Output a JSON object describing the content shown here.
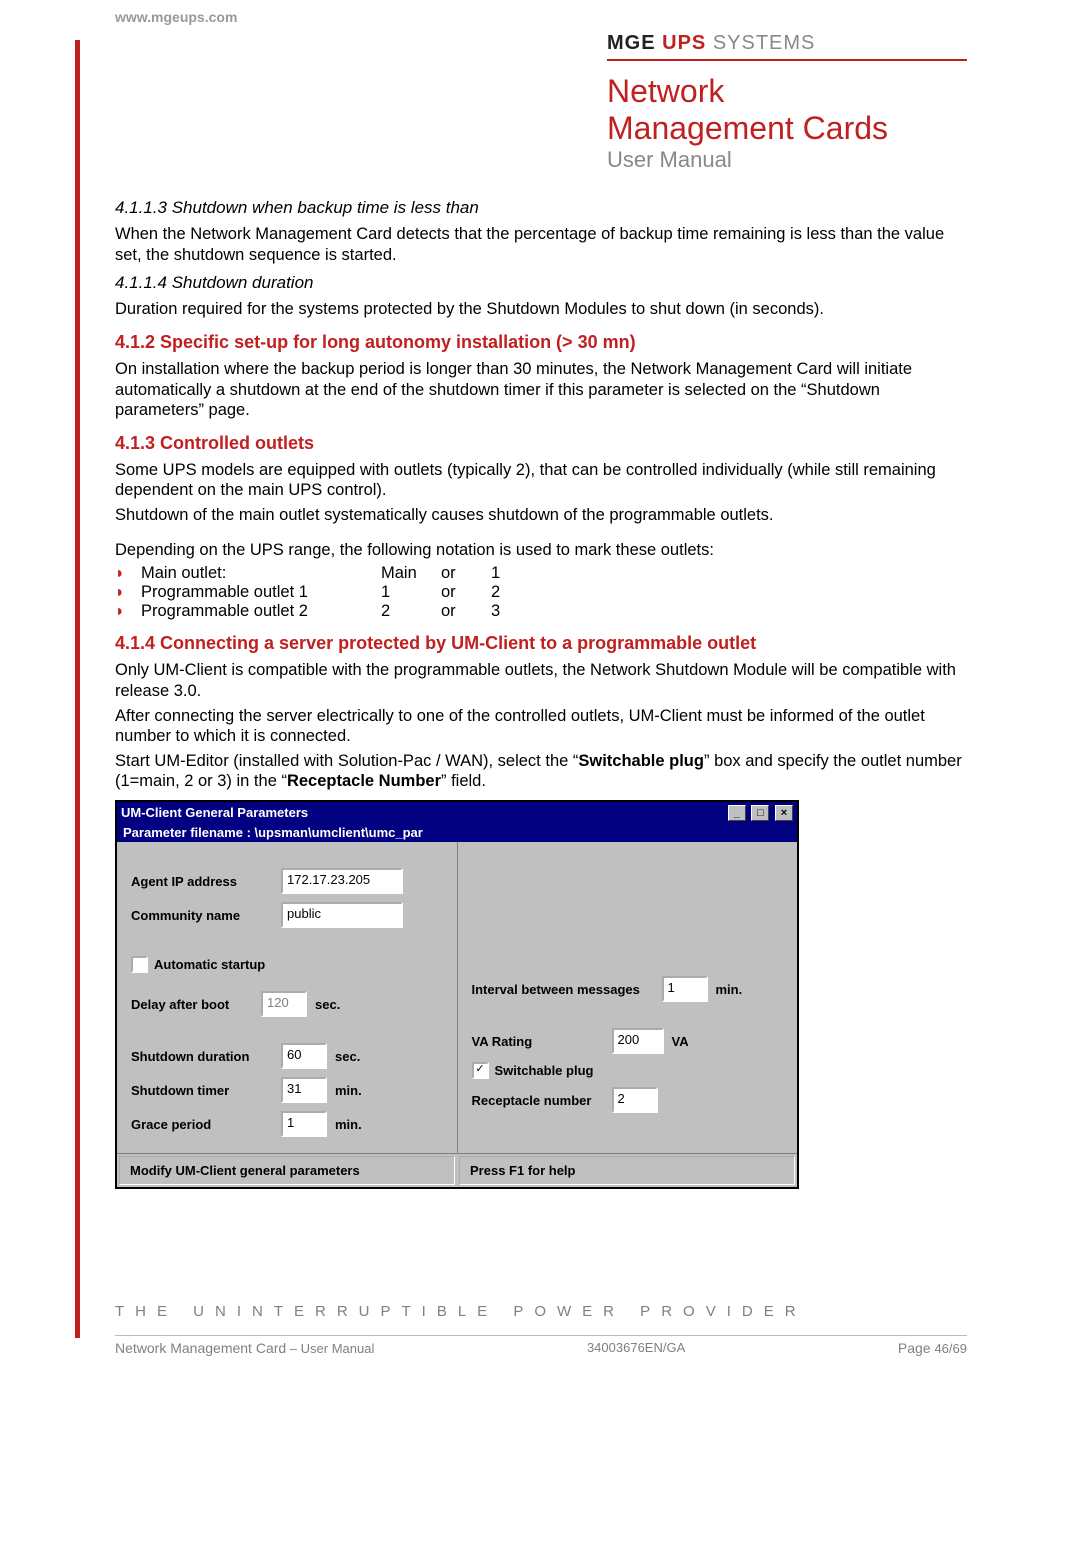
{
  "url": "www.mgeups.com",
  "brand": {
    "mge": "MGE",
    "ups": "UPS",
    "systems": "SYSTEMS"
  },
  "title": {
    "line1": "Network",
    "line2": "Management Cards",
    "sub": "User Manual"
  },
  "sections": {
    "s4113_heading": "4.1.1.3   Shutdown when backup time is less than",
    "s4113_body": "When the Network Management Card detects that the percentage of backup time remaining is less than the value set, the shutdown sequence is started.",
    "s4114_heading": "4.1.1.4   Shutdown duration",
    "s4114_body": "Duration required for the systems protected by the Shutdown Modules to shut down (in seconds).",
    "s412_heading": "4.1.2   Specific set-up for long autonomy installation  (> 30 mn)",
    "s412_body": "On  installation where the backup period is longer than 30 minutes, the Network Management Card will initiate automatically a shutdown at the end of the shutdown timer if this parameter is selected on the “Shutdown parameters” page.",
    "s413_heading": "4.1.3   Controlled outlets",
    "s413_body1": "Some UPS models are equipped with outlets (typically 2), that can be controlled individually (while still remaining dependent on the main UPS control).",
    "s413_body2": "Shutdown of the main outlet systematically causes shutdown of the programmable outlets.",
    "s413_body3": "Depending on the UPS range, the following notation is used to mark these outlets:",
    "outlets": [
      {
        "label": "Main outlet:",
        "c1": "Main",
        "c2": "or",
        "c3": "1"
      },
      {
        "label": "Programmable outlet 1",
        "c1": "1",
        "c2": "or",
        "c3": "2"
      },
      {
        "label": "Programmable outlet 2",
        "c1": "2",
        "c2": "or",
        "c3": "3"
      }
    ],
    "s414_heading": "4.1.4   Connecting a server protected by UM-Client to a programmable outlet",
    "s414_body1": "Only UM-Client is compatible with the programmable outlets, the Network Shutdown Module will be compatible with release 3.0.",
    "s414_body2": "After connecting the server electrically to one of the controlled outlets, UM-Client must be informed of the outlet number to which it is connected.",
    "s414_body3a": "Start UM-Editor (installed with Solution-Pac / WAN), select the “",
    "s414_body3b": "Switchable plug",
    "s414_body3c": "”  box and specify the outlet number (1=main, 2 or 3) in the “",
    "s414_body3d": "Receptacle Number",
    "s414_body3e": "” field."
  },
  "window": {
    "title": "UM-Client General Parameters",
    "subtitle": "Parameter filename : \\upsman\\umclient\\umc_par",
    "agent_ip_label": "Agent IP address",
    "agent_ip_value": "172.17.23.205",
    "community_label": "Community name",
    "community_value": "public",
    "auto_startup_label": "Automatic startup",
    "auto_startup_checked": false,
    "delay_label": "Delay after boot",
    "delay_value": "120",
    "delay_unit": "sec.",
    "interval_label": "Interval between messages",
    "interval_value": "1",
    "interval_unit": "min.",
    "shutdown_dur_label": "Shutdown duration",
    "shutdown_dur_value": "60",
    "shutdown_dur_unit": "sec.",
    "va_label": "VA Rating",
    "va_value": "200",
    "va_unit": "VA",
    "shutdown_timer_label": "Shutdown timer",
    "shutdown_timer_value": "31",
    "shutdown_timer_unit": "min.",
    "switchable_label": "Switchable plug",
    "switchable_checked": true,
    "grace_label": "Grace period",
    "grace_value": "1",
    "grace_unit": "min.",
    "receptacle_label": "Receptacle number",
    "receptacle_value": "2",
    "status_left": "Modify UM-Client general parameters",
    "status_right": "Press F1 for help"
  },
  "tagline": "THE UNINTERRUPTIBLE POWER PROVIDER",
  "footer": {
    "left_a": "Network Management Card",
    "left_b": " – User Manual",
    "center": "34003676EN/GA",
    "right_a": "Page ",
    "right_b": "46/69"
  }
}
